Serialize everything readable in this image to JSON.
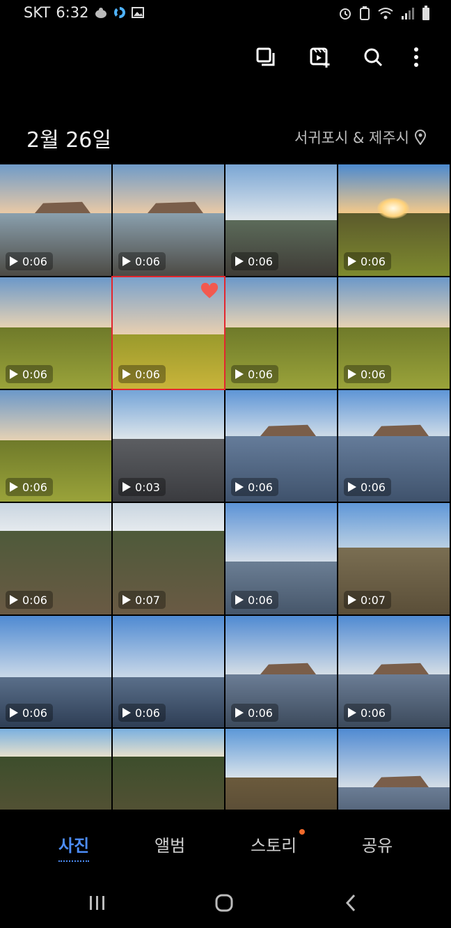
{
  "status": {
    "carrier": "SKT",
    "time": "6:32"
  },
  "header": {
    "date_title": "2월 26일",
    "location": "서귀포시 & 제주시"
  },
  "toolbar": {
    "icons": [
      "select-icon",
      "create-video-icon",
      "search-icon",
      "more-icon"
    ]
  },
  "photos": [
    {
      "duration": "0:06",
      "scene": "rock"
    },
    {
      "duration": "0:06",
      "scene": "rock"
    },
    {
      "duration": "0:06",
      "scene": "shore"
    },
    {
      "duration": "0:06",
      "scene": "sunset"
    },
    {
      "duration": "0:06",
      "scene": "field"
    },
    {
      "duration": "0:06",
      "scene": "field-bright",
      "selected": true,
      "favorite": true
    },
    {
      "duration": "0:06",
      "scene": "field"
    },
    {
      "duration": "0:06",
      "scene": "field"
    },
    {
      "duration": "0:06",
      "scene": "field"
    },
    {
      "duration": "0:03",
      "scene": "road"
    },
    {
      "duration": "0:06",
      "scene": "water-rock"
    },
    {
      "duration": "0:06",
      "scene": "water-rock"
    },
    {
      "duration": "0:06",
      "scene": "trail"
    },
    {
      "duration": "0:07",
      "scene": "trail"
    },
    {
      "duration": "0:06",
      "scene": "flat-water"
    },
    {
      "duration": "0:07",
      "scene": "grass"
    },
    {
      "duration": "0:06",
      "scene": "sea"
    },
    {
      "duration": "0:06",
      "scene": "sea"
    },
    {
      "duration": "0:06",
      "scene": "sea-rock"
    },
    {
      "duration": "0:06",
      "scene": "sea-rock"
    },
    {
      "duration": "",
      "scene": "trees"
    },
    {
      "duration": "",
      "scene": "trees"
    },
    {
      "duration": "",
      "scene": "bush"
    },
    {
      "duration": "",
      "scene": "sea-rock"
    }
  ],
  "bottom_nav": {
    "photos": "사진",
    "albums": "앨범",
    "stories": "스토리",
    "sharing": "공유"
  },
  "colors": {
    "accent": "#4d8df6",
    "selection": "#e3262e",
    "notification": "#f06a2b"
  }
}
